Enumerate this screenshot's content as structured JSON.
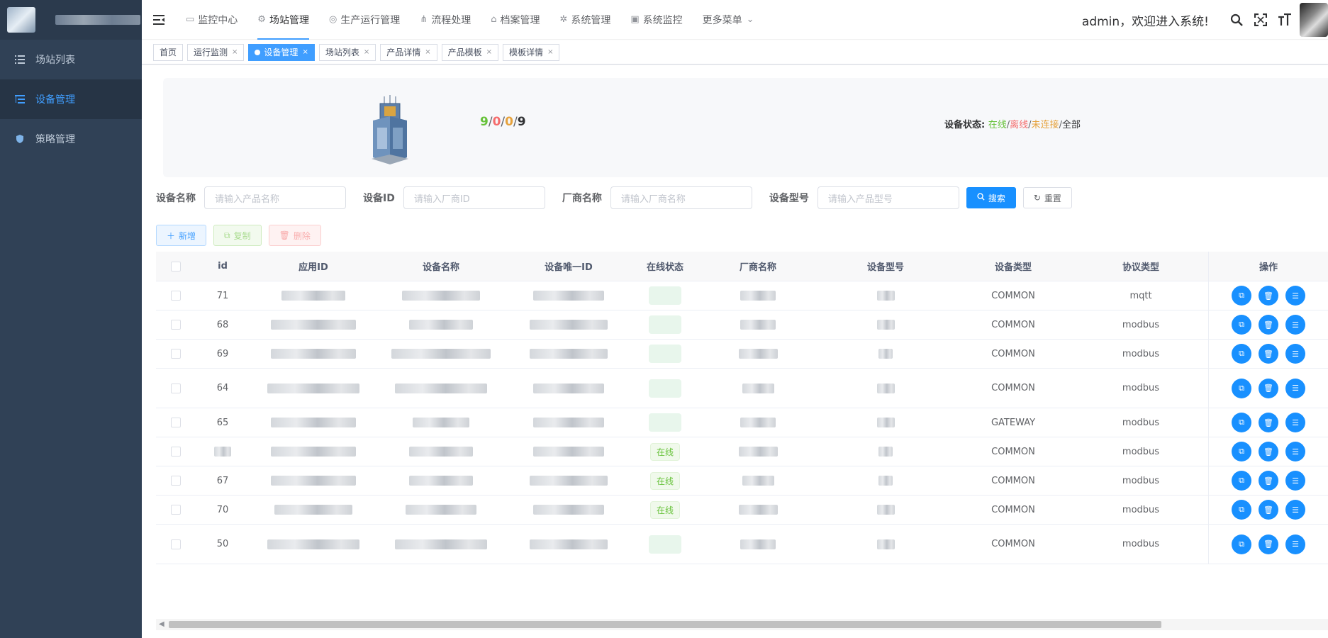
{
  "sidebar": {
    "items": [
      {
        "label": "场站列表",
        "icon": "list-icon",
        "active": false
      },
      {
        "label": "设备管理",
        "icon": "tree-list-icon",
        "active": true
      },
      {
        "label": "策略管理",
        "icon": "shield-icon",
        "active": false
      }
    ]
  },
  "topnav": {
    "items": [
      {
        "label": "监控中心",
        "icon": "monitor-icon"
      },
      {
        "label": "场站管理",
        "icon": "station-icon",
        "active": true
      },
      {
        "label": "生产运行管理",
        "icon": "dashboard-icon"
      },
      {
        "label": "流程处理",
        "icon": "flow-icon"
      },
      {
        "label": "档案管理",
        "icon": "archive-icon"
      },
      {
        "label": "系统管理",
        "icon": "gear-icon"
      },
      {
        "label": "系统监控",
        "icon": "chart-icon"
      },
      {
        "label": "更多菜单",
        "icon": "chevron-down-icon"
      }
    ],
    "welcome": "admin，欢迎进入系统!"
  },
  "tags": [
    {
      "label": "首页",
      "closable": false,
      "active": false
    },
    {
      "label": "运行监测",
      "closable": true,
      "active": false
    },
    {
      "label": "设备管理",
      "closable": true,
      "active": true
    },
    {
      "label": "场站列表",
      "closable": true,
      "active": false
    },
    {
      "label": "产品详情",
      "closable": true,
      "active": false
    },
    {
      "label": "产品模板",
      "closable": true,
      "active": false
    },
    {
      "label": "模板详情",
      "closable": true,
      "active": false
    }
  ],
  "summary": {
    "online": "9",
    "offline": "0",
    "unconnected": "0",
    "total": "9",
    "status_label": "设备状态:",
    "legend_online": "在线",
    "legend_offline": "离线",
    "legend_unconnected": "未连接",
    "legend_all": "全部"
  },
  "search": {
    "name_label": "设备名称",
    "name_placeholder": "请输入产品名称",
    "id_label": "设备ID",
    "id_placeholder": "请输入厂商ID",
    "vendor_label": "厂商名称",
    "vendor_placeholder": "请输入厂商名称",
    "model_label": "设备型号",
    "model_placeholder": "请输入产品型号",
    "search_btn": "搜索",
    "reset_btn": "重置"
  },
  "actions": {
    "add": "新增",
    "copy": "复制",
    "delete": "删除"
  },
  "table": {
    "columns": [
      "id",
      "应用ID",
      "设备名称",
      "设备唯一ID",
      "在线状态",
      "厂商名称",
      "设备型号",
      "设备类型",
      "协议类型",
      "操作"
    ],
    "rows": [
      {
        "id": "71",
        "type": "COMMON",
        "protocol": "mqtt",
        "online": ""
      },
      {
        "id": "68",
        "type": "COMMON",
        "protocol": "modbus",
        "online": ""
      },
      {
        "id": "69",
        "type": "COMMON",
        "protocol": "modbus",
        "online": ""
      },
      {
        "id": "64",
        "type": "COMMON",
        "protocol": "modbus",
        "online": ""
      },
      {
        "id": "65",
        "type": "GATEWAY",
        "protocol": "modbus",
        "online": ""
      },
      {
        "id": "",
        "type": "COMMON",
        "protocol": "modbus",
        "online": "在线"
      },
      {
        "id": "67",
        "type": "COMMON",
        "protocol": "modbus",
        "online": "在线"
      },
      {
        "id": "70",
        "type": "COMMON",
        "protocol": "modbus",
        "online": "在线"
      },
      {
        "id": "50",
        "type": "COMMON",
        "protocol": "modbus",
        "online": ""
      }
    ]
  },
  "colors": {
    "accent": "#1890ff",
    "sidebar_bg": "#304156",
    "online": "#67c23a",
    "offline": "#f56c6c",
    "unconnected": "#e6a23c"
  }
}
